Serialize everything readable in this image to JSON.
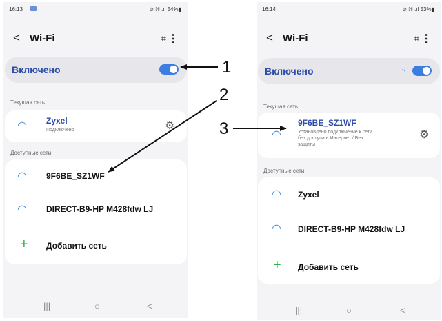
{
  "left_screen": {
    "status": {
      "time": "16:13",
      "right": "⊜ ℍ .ıl 54%▮"
    },
    "header": {
      "back": "<",
      "title": "Wi-Fi",
      "scan": "⌗",
      "more": "⋮"
    },
    "toggle_label": "Включено",
    "current_section": "Текущая сеть",
    "current": {
      "name": "Zyxel",
      "status": "Подключено"
    },
    "available_section": "Доступные сети",
    "networks": [
      "9F6BE_SZ1WF",
      "DIRECT-B9-HP M428fdw LJ"
    ],
    "add_network": "Добавить сеть",
    "nav": {
      "recents": "|||",
      "home": "○",
      "back": "<"
    }
  },
  "right_screen": {
    "status": {
      "time": "16:14",
      "right": "⊜ ℍ .ıl 53%▮"
    },
    "header": {
      "back": "<",
      "title": "Wi-Fi",
      "scan": "⌗",
      "more": "⋮"
    },
    "toggle_label": "Включено",
    "current_section": "Текущая сеть",
    "current": {
      "name": "9F6BE_SZ1WF",
      "status_lines": [
        "Установлено подключение к сети",
        "без доступа в Интернет / Без",
        "защиты"
      ]
    },
    "available_section": "Доступные сети",
    "networks": [
      "Zyxel",
      "DIRECT-B9-HP M428fdw LJ"
    ],
    "add_network": "Добавить сеть",
    "nav": {
      "recents": "|||",
      "home": "○",
      "back": "<"
    }
  },
  "annotations": {
    "one": "1",
    "two": "2",
    "three": "3"
  },
  "colors": {
    "accent": "#3b7de0",
    "label_blue": "#2e4da8",
    "add_green": "#2bb24c"
  }
}
